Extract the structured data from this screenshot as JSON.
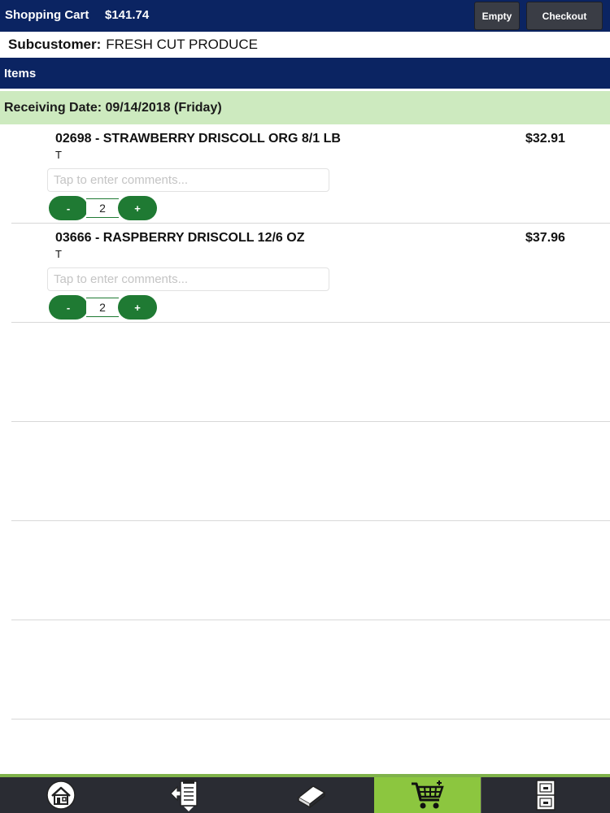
{
  "header": {
    "title": "Shopping Cart",
    "total": "$141.74",
    "empty_label": "Empty",
    "checkout_label": "Checkout"
  },
  "subcustomer": {
    "label": "Subcustomer:",
    "value": "FRESH CUT PRODUCE"
  },
  "items_header": "Items",
  "receiving": {
    "label": "Receiving Date: 09/14/2018 (Friday)"
  },
  "items": [
    {
      "name": "02698 - STRAWBERRY DRISCOLL ORG 8/1 LB",
      "price": "$32.91",
      "sub": "T",
      "comment_placeholder": "Tap to enter comments...",
      "minus": "-",
      "qty": "2",
      "plus": "+"
    },
    {
      "name": "03666 - RASPBERRY DRISCOLL 12/6 OZ",
      "price": "$37.96",
      "sub": "T",
      "comment_placeholder": "Tap to enter comments...",
      "minus": "-",
      "qty": "2",
      "plus": "+"
    }
  ],
  "tabs": [
    {
      "icon": "home-icon"
    },
    {
      "icon": "order-clipboard-icon"
    },
    {
      "icon": "catalog-book-icon"
    },
    {
      "icon": "shopping-cart-icon",
      "active": true
    },
    {
      "icon": "file-cabinet-icon"
    }
  ],
  "colors": {
    "header_bg": "#0b2462",
    "receiving_bg": "#cdeabf",
    "stepper_green": "#1f7a33",
    "active_tab": "#8cc63f"
  }
}
